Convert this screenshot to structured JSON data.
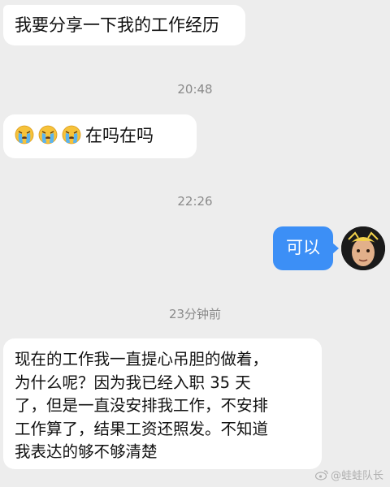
{
  "messages": [
    {
      "text": "我要分享一下我的工作经历"
    },
    {
      "emoji_icons": [
        "crying-face-icon",
        "crying-face-icon",
        "crying-face-icon"
      ],
      "text": "在吗在吗"
    },
    {
      "text": "可以"
    },
    {
      "lines": [
        "现在的工作我一直提心吊胆的做着，",
        "为什么呢？因为我已经入职 35 天",
        "了，但是一直没安排我工作，不安排",
        "工作算了，结果工资还照发。不知道",
        "我表达的够不够清楚"
      ]
    }
  ],
  "timestamps": [
    "20:48",
    "22:26",
    "23分钟前"
  ],
  "watermark": {
    "text": "@蛙蛙队长",
    "icon": "weibo-logo-icon"
  },
  "colors": {
    "background": "#ededed",
    "self_bubble": "#3c8ff6",
    "other_bubble": "#ffffff",
    "timestamp": "#8a8a8a"
  }
}
